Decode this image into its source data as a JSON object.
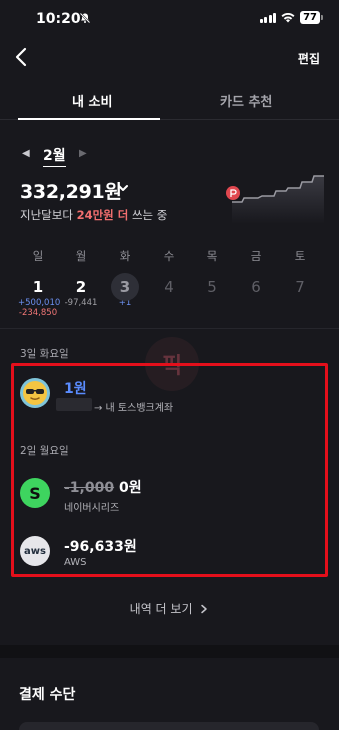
{
  "status": {
    "time": "10:20",
    "battery": "77"
  },
  "nav": {
    "edit_label": "편집"
  },
  "tabs": [
    {
      "label": "내 소비",
      "active": true
    },
    {
      "label": "카드 추천",
      "active": false
    }
  ],
  "month": {
    "label": "2월",
    "prev_symbol": "◀",
    "next_symbol": "▶"
  },
  "summary": {
    "total": "332,291원",
    "compare_prefix": "지난달보다",
    "compare_highlight": "24만원 더",
    "compare_suffix": "쓰는 중"
  },
  "week": [
    {
      "name": "일",
      "num": "1",
      "plus": "+500,010",
      "minus": "-234,850"
    },
    {
      "name": "월",
      "num": "2",
      "plain": "-97,441"
    },
    {
      "name": "화",
      "num": "3",
      "plus": "+1",
      "today": true
    },
    {
      "name": "수",
      "num": "4"
    },
    {
      "name": "목",
      "num": "5"
    },
    {
      "name": "금",
      "num": "6"
    },
    {
      "name": "토",
      "num": "7"
    }
  ],
  "groups": [
    {
      "date": "3일 화요일"
    },
    {
      "date": "2일 월요일"
    }
  ],
  "transactions": [
    {
      "amount": "1원",
      "sub": "→ 내 토스뱅크계좌",
      "icon": "sunglasses-emoji-icon"
    },
    {
      "original": "-1,000",
      "amount": "0원",
      "sub": "네이버시리즈",
      "icon": "naver-series-icon",
      "icon_text": "S"
    },
    {
      "amount": "-96,633원",
      "sub": "AWS",
      "icon": "aws-icon",
      "icon_text": "aws"
    }
  ],
  "more_label": "내역 더 보기",
  "payment": {
    "title": "결제 수단"
  },
  "colors": {
    "background": "#18181d",
    "highlight_red": "#f36f6f",
    "plus_blue": "#6b8fee",
    "link_blue": "#5a8cff",
    "annotation_box": "#e40f1b"
  }
}
